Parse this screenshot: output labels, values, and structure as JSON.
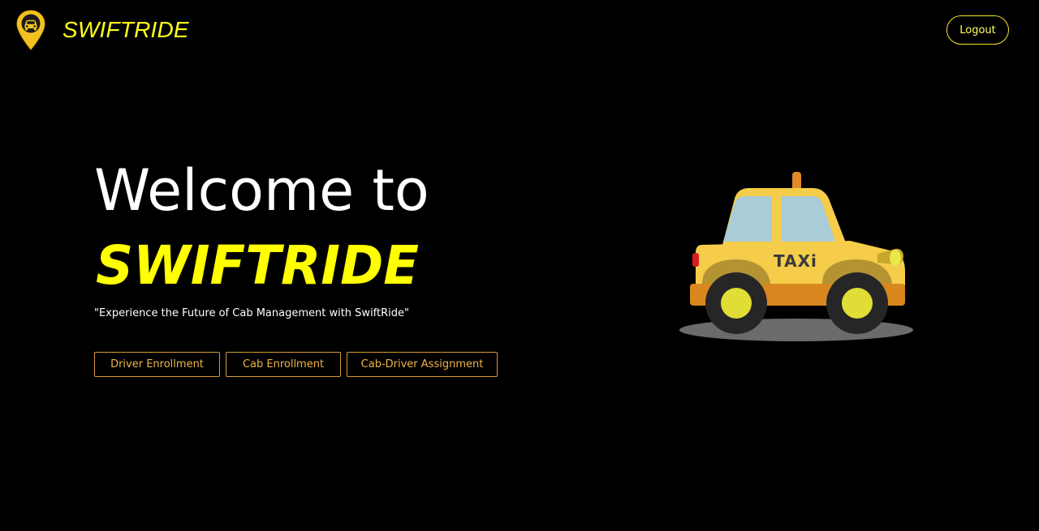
{
  "header": {
    "brand": "SWIFTRIDE",
    "logo_icon": "car-location-pin-icon",
    "logout_label": "Logout"
  },
  "hero": {
    "title_line1": "Welcome to",
    "title_line2": "SWIFTRIDE",
    "tagline": "\"Experience the Future of Cab Management with SwiftRide\""
  },
  "actions": {
    "driver_enrollment": "Driver Enrollment",
    "cab_enrollment": "Cab Enrollment",
    "cab_driver_assignment": "Cab-Driver Assignment"
  },
  "illustration": {
    "icon": "taxi-car-illustration",
    "sign_text": "TAXi"
  },
  "colors": {
    "background": "#000000",
    "brand_yellow": "#ffff00",
    "button_orange": "#f0b446",
    "taxi_yellow": "#f5cd4a"
  }
}
